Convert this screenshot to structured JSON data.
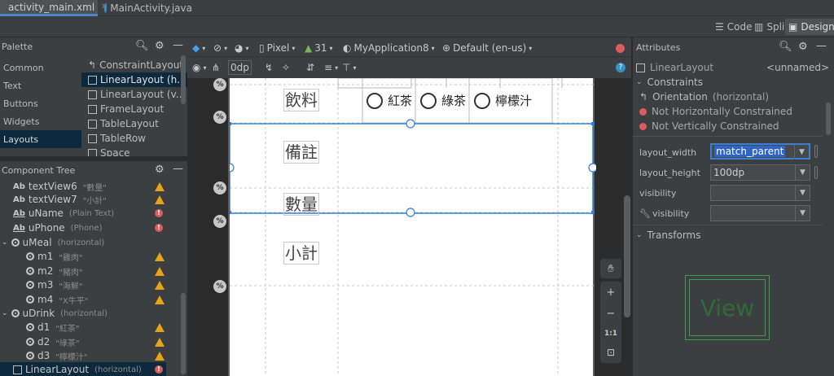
{
  "tabs": [
    {
      "label": "activity_main.xml",
      "active": true
    },
    {
      "label": "MainActivity.java",
      "active": false
    }
  ],
  "modes": {
    "code": "Code",
    "split": "Split",
    "design": "Design"
  },
  "palette": {
    "title": "Palette",
    "categories": [
      "Common",
      "Text",
      "Buttons",
      "Widgets",
      "Layouts"
    ],
    "selected_category": "Layouts",
    "items": [
      "ConstraintLayout",
      "LinearLayout (h...",
      "LinearLayout (v...",
      "FrameLayout",
      "TableLayout",
      "TableRow",
      "Space"
    ]
  },
  "component_tree": {
    "title": "Component Tree",
    "nodes": [
      {
        "label": "textView6",
        "sub": "\"數量\"",
        "icon": "Ab",
        "status": "warn"
      },
      {
        "label": "textView7",
        "sub": "\"小計\"",
        "icon": "Ab",
        "status": "warn"
      },
      {
        "label": "uName",
        "sub": "(Plain Text)",
        "icon": "Ab_",
        "status": "err"
      },
      {
        "label": "uPhone",
        "sub": "(Phone)",
        "icon": "Ab_",
        "status": "err"
      },
      {
        "label": "uMeal",
        "sub": "(horizontal)",
        "icon": "radiogroup",
        "status": ""
      },
      {
        "label": "m1",
        "sub": "\"雞肉\"",
        "icon": "radio",
        "status": "warn"
      },
      {
        "label": "m2",
        "sub": "\"豬肉\"",
        "icon": "radio",
        "status": "warn"
      },
      {
        "label": "m3",
        "sub": "\"海鮮\"",
        "icon": "radio",
        "status": "warn"
      },
      {
        "label": "m4",
        "sub": "\"X牛平\"",
        "icon": "radio",
        "status": "warn"
      },
      {
        "label": "uDrink",
        "sub": "(horizontal)",
        "icon": "radiogroup",
        "status": ""
      },
      {
        "label": "d1",
        "sub": "\"紅茶\"",
        "icon": "radio",
        "status": "warn"
      },
      {
        "label": "d2",
        "sub": "\"綠茶\"",
        "icon": "radio",
        "status": "warn"
      },
      {
        "label": "d3",
        "sub": "\"檸檬汁\"",
        "icon": "radio",
        "status": "warn"
      },
      {
        "label": "LinearLayout",
        "sub": "(horizontal)",
        "icon": "linear",
        "status": "err"
      }
    ]
  },
  "toolbar": {
    "device": "Pixel",
    "api": "31",
    "app": "MyApplication8",
    "locale": "Default (en-us)",
    "margin": "0dp"
  },
  "design": {
    "labels": [
      "飲料",
      "備註",
      "數量",
      "小計"
    ],
    "drinks": [
      "紅茶",
      "綠茶",
      "檸檬汁"
    ],
    "badge": "%"
  },
  "zoom": {
    "one_to_one": "1:1",
    "plus": "+",
    "minus": "−"
  },
  "attributes": {
    "title": "Attributes",
    "component": "LinearLayout",
    "component_id": "<unnamed>",
    "constraints_title": "Constraints",
    "orientation_label": "Orientation",
    "orientation_value": "(horizontal)",
    "issues": [
      "Not Horizontally Constrained",
      "Not Vertically Constrained"
    ],
    "fields": [
      {
        "label": "layout_width",
        "value": "match_parent"
      },
      {
        "label": "layout_height",
        "value": "100dp"
      },
      {
        "label": "visibility",
        "value": ""
      },
      {
        "label": "visibility",
        "value": ""
      }
    ],
    "transforms_title": "Transforms",
    "preview_text": "View"
  }
}
